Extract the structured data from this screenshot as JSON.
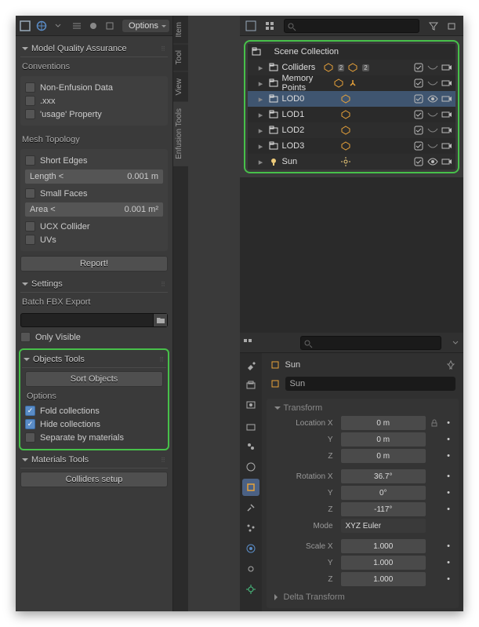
{
  "left": {
    "options_label": "Options",
    "sections": {
      "mqa": {
        "title": "Model Quality Assurance"
      },
      "conventions": {
        "title": "Conventions",
        "items": [
          "Non-Enfusion Data",
          ".xxx",
          "'usage' Property"
        ]
      },
      "mesh": {
        "title": "Mesh Topology",
        "short_edges": "Short Edges",
        "length_lbl": "Length <",
        "length_val": "0.001 m",
        "small_faces": "Small Faces",
        "area_lbl": "Area <",
        "area_val": "0.001 m²",
        "ucx": "UCX Collider",
        "uvs": "UVs",
        "report": "Report!"
      },
      "settings": {
        "title": "Settings",
        "batch": "Batch FBX Export",
        "only_visible": "Only Visible"
      },
      "objects": {
        "title": "Objects Tools",
        "sort": "Sort Objects",
        "options": "Options",
        "fold": "Fold collections",
        "hide": "Hide collections",
        "separate": "Separate by materials"
      },
      "materials": {
        "title": "Materials Tools",
        "colliders": "Colliders setup"
      }
    },
    "tabs": [
      "Item",
      "Tool",
      "View",
      "Enfusion Tools"
    ]
  },
  "outliner": {
    "title": "Scene Collection",
    "rows": [
      {
        "name": "Colliders",
        "badge": "2",
        "badge2": "2",
        "sel": false,
        "icon": "collection"
      },
      {
        "name": "Memory Points",
        "sel": false,
        "icon": "collection"
      },
      {
        "name": "LOD0",
        "sel": true,
        "icon": "collection"
      },
      {
        "name": "LOD1",
        "sel": false,
        "icon": "collection"
      },
      {
        "name": "LOD2",
        "sel": false,
        "icon": "collection"
      },
      {
        "name": "LOD3",
        "sel": false,
        "icon": "collection"
      },
      {
        "name": "Sun",
        "sel": false,
        "icon": "light"
      }
    ]
  },
  "props": {
    "chip_name": "Sun",
    "field_name": "Sun",
    "transform": {
      "title": "Transform",
      "loc_lbl": "Location X",
      "loc_x": "0 m",
      "loc_y": "0 m",
      "loc_z": "0 m",
      "rot_lbl": "Rotation X",
      "rot_x": "36.7°",
      "rot_y": "0°",
      "rot_z": "-117°",
      "mode_lbl": "Mode",
      "mode_val": "XYZ Euler",
      "scale_lbl": "Scale X",
      "scale_x": "1.000",
      "scale_y": "1.000",
      "scale_z": "1.000",
      "y": "Y",
      "z": "Z",
      "delta": "Delta Transform"
    }
  }
}
